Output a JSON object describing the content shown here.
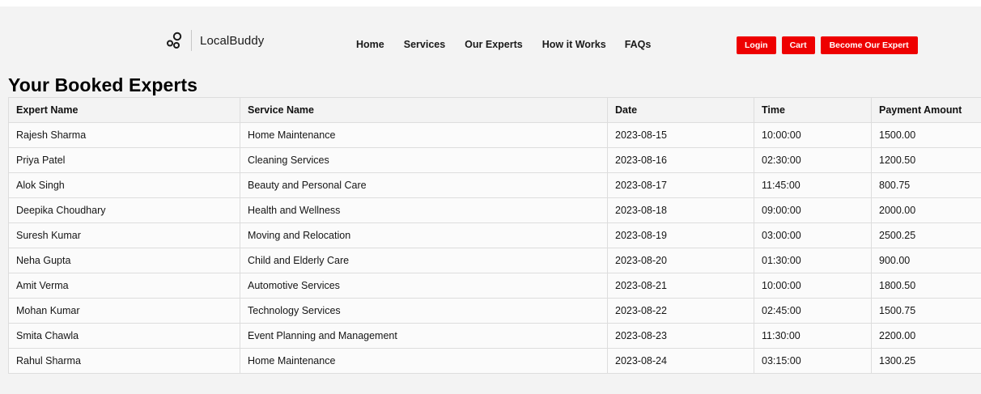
{
  "header": {
    "brand_name": "LocalBuddy",
    "brand_icon": "three-circles-logo-icon",
    "nav_links": [
      "Home",
      "Services",
      "Our Experts",
      "How it Works",
      "FAQs"
    ],
    "actions": {
      "login_label": "Login",
      "cart_label": "Cart",
      "become_expert_label": "Become Our Expert"
    },
    "accent_color": "#ee0000"
  },
  "main": {
    "title": "Your Booked Experts",
    "table": {
      "columns": [
        "Expert Name",
        "Service Name",
        "Date",
        "Time",
        "Payment Amount"
      ],
      "rows": [
        [
          "Rajesh Sharma",
          "Home Maintenance",
          "2023-08-15",
          "10:00:00",
          "1500.00"
        ],
        [
          "Priya Patel",
          "Cleaning Services",
          "2023-08-16",
          "02:30:00",
          "1200.50"
        ],
        [
          "Alok Singh",
          "Beauty and Personal Care",
          "2023-08-17",
          "11:45:00",
          "800.75"
        ],
        [
          "Deepika Choudhary",
          "Health and Wellness",
          "2023-08-18",
          "09:00:00",
          "2000.00"
        ],
        [
          "Suresh Kumar",
          "Moving and Relocation",
          "2023-08-19",
          "03:00:00",
          "2500.25"
        ],
        [
          "Neha Gupta",
          "Child and Elderly Care",
          "2023-08-20",
          "01:30:00",
          "900.00"
        ],
        [
          "Amit Verma",
          "Automotive Services",
          "2023-08-21",
          "10:00:00",
          "1800.50"
        ],
        [
          "Mohan Kumar",
          "Technology Services",
          "2023-08-22",
          "02:45:00",
          "1500.75"
        ],
        [
          "Smita Chawla",
          "Event Planning and Management",
          "2023-08-23",
          "11:30:00",
          "2200.00"
        ],
        [
          "Rahul Sharma",
          "Home Maintenance",
          "2023-08-24",
          "03:15:00",
          "1300.25"
        ]
      ]
    }
  }
}
